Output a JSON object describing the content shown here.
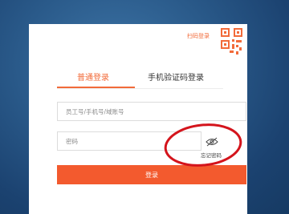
{
  "header": {
    "scan_login_label": "扫码登录"
  },
  "tabs": [
    {
      "label": "普通登录",
      "active": true
    },
    {
      "label": "手机验证码登录",
      "active": false
    }
  ],
  "form": {
    "username_placeholder": "员工号/手机号/域账号",
    "password_placeholder": "密码",
    "forgot_password": "忘记密码",
    "login_button": "登录"
  },
  "icons": {
    "qr": "qr-code-icon",
    "password_visibility": "eye-slash-icon"
  },
  "colors": {
    "accent": "#f26b3a",
    "button": "#f35a2e",
    "annotation": "#d4141c"
  }
}
